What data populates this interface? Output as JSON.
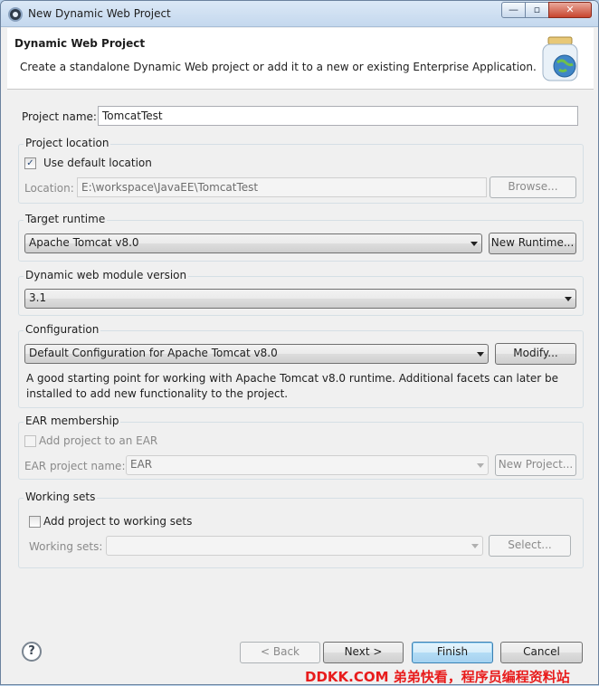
{
  "window": {
    "title": "New Dynamic Web Project",
    "controls": {
      "minimize": "—",
      "maximize": "▫",
      "close": "✕"
    }
  },
  "banner": {
    "title": "Dynamic Web Project",
    "description": "Create a standalone Dynamic Web project or add it to a new or existing Enterprise Application."
  },
  "project_name": {
    "label": "Project name:",
    "value": "TomcatTest"
  },
  "project_location": {
    "group_label": "Project location",
    "use_default_label": "Use default location",
    "use_default_checked": "✓",
    "location_label": "Location:",
    "location_value": "E:\\workspace\\JavaEE\\TomcatTest",
    "browse_label": "Browse..."
  },
  "target_runtime": {
    "group_label": "Target runtime",
    "selected": "Apache Tomcat v8.0",
    "new_runtime_label": "New Runtime..."
  },
  "module_version": {
    "group_label": "Dynamic web module version",
    "selected": "3.1"
  },
  "configuration": {
    "group_label": "Configuration",
    "selected": "Default Configuration for Apache Tomcat v8.0",
    "modify_label": "Modify...",
    "description_line1": "A good starting point for working with Apache Tomcat v8.0 runtime. Additional facets can later be",
    "description_line2": "installed to add new functionality to the project."
  },
  "ear_membership": {
    "group_label": "EAR membership",
    "add_to_ear_label": "Add project to an EAR",
    "ear_name_label": "EAR project name:",
    "ear_name_value": "EAR",
    "new_project_label": "New Project..."
  },
  "working_sets": {
    "group_label": "Working sets",
    "add_label": "Add project to working sets",
    "sets_label": "Working sets:",
    "sets_value": "",
    "select_label": "Select..."
  },
  "footer": {
    "help_glyph": "?",
    "back_label": "< Back",
    "next_label": "Next >",
    "finish_label": "Finish",
    "cancel_label": "Cancel"
  },
  "watermark": "DDKK.COM 弟弟快看，程序员编程资料站"
}
